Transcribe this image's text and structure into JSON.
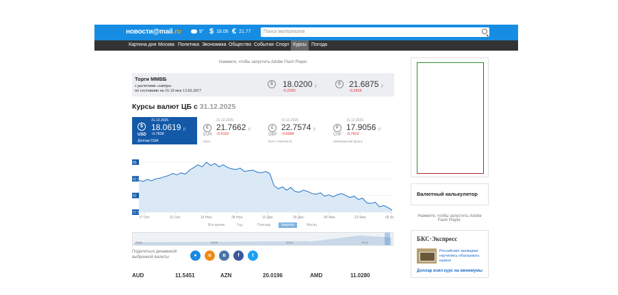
{
  "header": {
    "logo_news": "новости",
    "logo_at": "@",
    "logo_mail": "mail",
    "logo_ru": ".ru",
    "weather": "9°",
    "usd_symbol": "$",
    "usd_value": "18.06",
    "eur_symbol": "€",
    "eur_value": "21.77",
    "search_placeholder": "Поиск материалов"
  },
  "nav": {
    "items": [
      "Картина дня",
      "Москва",
      "Политика",
      "Экономика",
      "Общество",
      "События",
      "Спорт",
      "Курсы",
      "Погода"
    ],
    "active": "Курсы"
  },
  "flash_note_top": "Нажмите, чтобы запустить Adobe Flash Player.",
  "moex": {
    "title": "Торги ММВБ",
    "sub1": "с расчетами «завтра»",
    "sub2": "по состоянию на 16.10 мск 13.02.2017",
    "usd_value": "18.0200",
    "usd_change": "-0.2200",
    "eur_value": "21.6875",
    "eur_change": "-0.2825",
    "rub": "р"
  },
  "cb": {
    "title": "Курсы валют ЦБ с",
    "date": "31.12.2025"
  },
  "rates": [
    {
      "date": "31.12.2025",
      "value": "18.0619",
      "change": "-0.7838",
      "code": "USD",
      "name": "Доллар США",
      "symbol": "$"
    },
    {
      "date": "31.12.2025",
      "value": "21.7662",
      "change": "-0.9162",
      "code": "EUR",
      "name": "Евро",
      "symbol": "€"
    },
    {
      "date": "31.12.2025",
      "value": "22.7574",
      "change": "-0.6684",
      "code": "GBP",
      "name": "Фунт стерлингов",
      "symbol": "£"
    },
    {
      "date": "31.12.2025",
      "value": "17.9056",
      "change": "-0.7815",
      "code": "CHF",
      "name": "Швейцарский франк",
      "symbol": "₣"
    }
  ],
  "chart_data": {
    "type": "area",
    "title": "",
    "y_ticks": [
      "65",
      "62.5",
      "60",
      "57.5"
    ],
    "x_ticks": [
      "17 Окт.",
      "31 Окт.",
      "14 Ноя.",
      "28 Ноя.",
      "12 Дек.",
      "26 Дек.",
      "09 Янв.",
      "23 Янв.",
      "06 Фев."
    ],
    "ylim": [
      57.5,
      65.5
    ],
    "values": [
      62.3,
      62.1,
      62.4,
      62.2,
      62.5,
      62.6,
      62.8,
      63.0,
      63.3,
      63.1,
      63.4,
      63.2,
      63.8,
      64.2,
      64.6,
      64.3,
      65.0,
      64.5,
      64.8,
      64.3,
      64.6,
      64.2,
      64.0,
      63.9,
      64.1,
      63.6,
      63.7,
      63.8,
      63.5,
      63.4,
      63.6,
      63.3,
      61.5,
      61.0,
      61.3,
      60.8,
      61.2,
      60.6,
      60.5,
      60.8,
      60.6,
      60.3,
      60.2,
      60.4,
      59.9,
      60.1,
      59.8,
      60.1,
      60.3,
      60.0,
      59.7,
      59.9,
      59.4,
      59.6,
      58.9,
      58.8,
      59.0,
      58.3,
      58.5,
      58.2,
      57.8
    ]
  },
  "periods": [
    "Все время",
    "Год",
    "Полгода",
    "Квартал",
    "Месяц"
  ],
  "active_period": "Квартал",
  "navigator_years": [
    "2000",
    "2005",
    "2010",
    "2015"
  ],
  "share": {
    "label": "Поделиться динамикой выбранной валюты"
  },
  "bottom_rates": [
    {
      "code": "AUD",
      "value": "11.5451"
    },
    {
      "code": "AZN",
      "value": "20.0196"
    },
    {
      "code": "AMD",
      "value": "11.0280"
    }
  ],
  "sidebar": {
    "flash_note": "Нажмите, чтобы запустить Adobe Flash Player.",
    "calc_title": "Валютный калькулятор",
    "bks_logo": "БКС·Экспресс",
    "bks_text": "Российские заемщики научились обыгрывать казино",
    "bks_link": "Доллар взял курс на минимумы"
  },
  "colors": {
    "brand_blue": "#168de2",
    "nav_dark": "#333333",
    "usd_card": "#1359a8",
    "negative": "#e03030"
  }
}
